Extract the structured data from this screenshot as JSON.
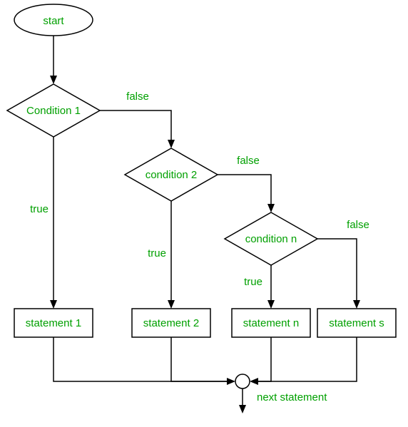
{
  "nodes": {
    "start": "start",
    "cond1": "Condition 1",
    "cond2": "condition 2",
    "condn": "condition n",
    "stmt1": "statement 1",
    "stmt2": "statement 2",
    "stmtn": "statement n",
    "stmts": "statement s",
    "next": "next statement"
  },
  "edges": {
    "true": "true",
    "false": "false"
  }
}
